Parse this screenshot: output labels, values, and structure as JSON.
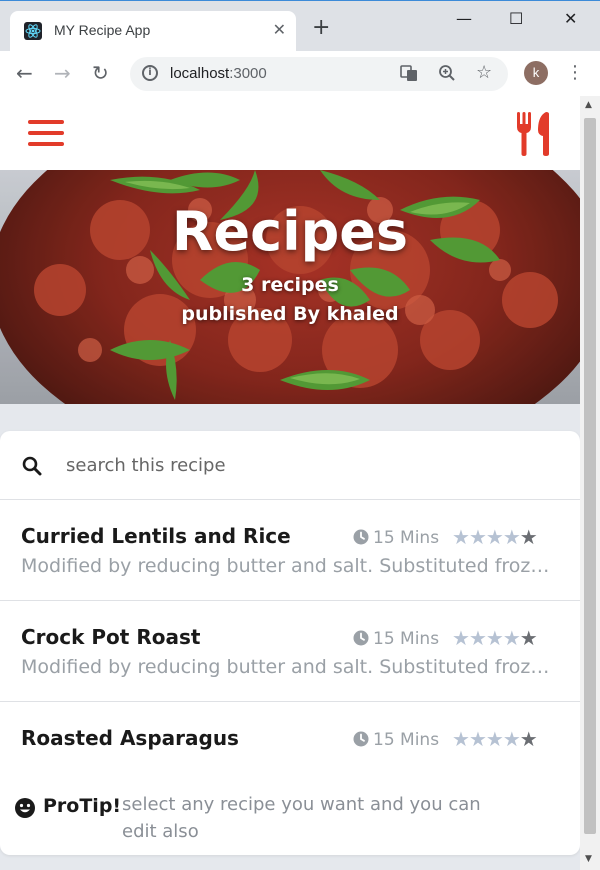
{
  "browser": {
    "tab_title": "MY Recipe App",
    "tab_close": "✕",
    "new_tab": "+",
    "url_host": "localhost",
    "url_port": ":3000",
    "profile_initial": "k",
    "window_controls": {
      "minimize": "—",
      "maximize": "☐",
      "close": "✕"
    }
  },
  "hero": {
    "title": "Recipes",
    "count": "3 recipes",
    "byline": "published By khaled"
  },
  "search": {
    "placeholder": "search this recipe"
  },
  "recipes": [
    {
      "name": "Curried Lentils and Rice",
      "time": "15 Mins",
      "rating": 4,
      "rating_max": 5,
      "description": "Modified by reducing butter and salt. Substituted frozen peas for fresh."
    },
    {
      "name": "Crock Pot Roast",
      "time": "15 Mins",
      "rating": 4,
      "rating_max": 5,
      "description": "Modified by reducing butter and salt. Substituted frozen peas for fresh."
    },
    {
      "name": "Roasted Asparagus",
      "time": "15 Mins",
      "rating": 4,
      "rating_max": 5,
      "description": ""
    }
  ],
  "protip": {
    "label": "ProTip!",
    "text": "select any recipe you want and you can edit also"
  },
  "colors": {
    "accent_red": "#e23b2a",
    "star_filled": "#b6c2d3",
    "star_empty": "#6b6e73"
  },
  "icons": {
    "menu": "hamburger-icon",
    "brand": "utensils-icon",
    "search": "search-icon",
    "time": "clock-icon",
    "rating": "star-icon",
    "tip": "smiley-icon"
  }
}
